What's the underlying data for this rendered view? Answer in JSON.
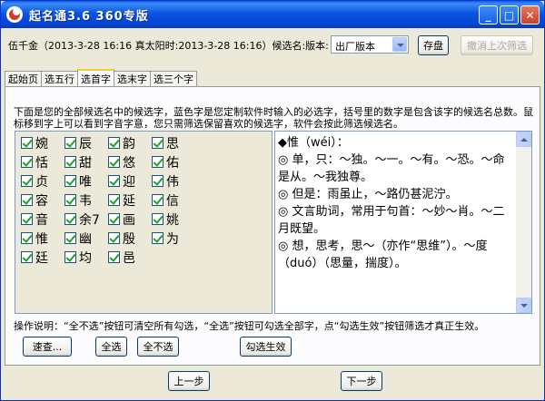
{
  "window": {
    "title": "起名通3.6 360专版"
  },
  "info": {
    "text": "伍千金（2013-3-28 16:16 真太阳时:2013-3-28 16:16）候选名:版本:"
  },
  "version_select": {
    "value": "出厂版本"
  },
  "buttons": {
    "save": "存盘",
    "undo_filter": "撤消上次筛选",
    "quick_check": "速查...",
    "select_all": "全选",
    "deselect_all": "全不选",
    "apply_checked": "勾选生效",
    "prev": "上一步",
    "next": "下一步"
  },
  "tabs": [
    "起始页",
    "选五行",
    "选首字",
    "选末字",
    "选三个字"
  ],
  "active_tab": "选首字",
  "description": "下面是您的全部候选名中的候选字，蓝色字是您定制软件时输入的必选字，括号里的数字是包含该字的候选名总数。鼠标移到字上可以看到字音字意，您只需筛选保留喜欢的候选字，软件会按此筛选候选名。",
  "candidates": [
    "婉",
    "辰",
    "韵",
    "思",
    "恬",
    "甜",
    "悠",
    "佑",
    "贞",
    "唯",
    "迎",
    "伟",
    "容",
    "韦",
    "延",
    "信",
    "音",
    "余7",
    "画",
    "姚",
    "惟",
    "幽",
    "殷",
    "为",
    "廷",
    "均",
    "邑"
  ],
  "detail": {
    "text": "◆惟（wéi）：\n◎ 单，只：～独。～一。～有。～恐。～命是从。～我独尊。\n◎ 但是：雨虽止，～路仍甚泥泞。\n◎ 文言助词，常用于句首：～妙～肖。～二月既望。\n◎ 想，思考，思～（亦作“思维”）。～度（duó）（思量，揣度）。"
  },
  "operation_note": "操作说明：“全不选”按钮可清空所有勾选，“全选”按钮可勾选全部字，点“勾选生效”按钮筛选才真正生效。"
}
